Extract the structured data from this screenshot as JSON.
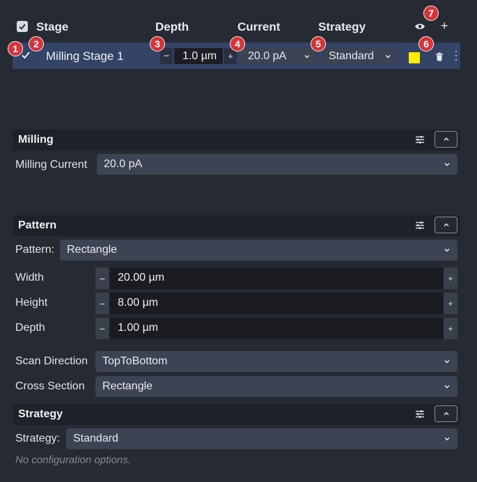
{
  "header": {
    "stage_label": "Stage",
    "depth_label": "Depth",
    "current_label": "Current",
    "strategy_label": "Strategy",
    "add_symbol": "+"
  },
  "stage_row": {
    "name": "Milling Stage 1",
    "depth_minus": "−",
    "depth_value": "1.0 µm",
    "depth_plus": "+",
    "current_value": "20.0 pA",
    "strategy_value": "Standard",
    "color": "#ffee00"
  },
  "badges": [
    "1",
    "2",
    "3",
    "4",
    "5",
    "6",
    "7"
  ],
  "milling": {
    "title": "Milling",
    "current_label": "Milling Current",
    "current_value": "20.0 pA"
  },
  "pattern": {
    "title": "Pattern",
    "pattern_label": "Pattern:",
    "pattern_value": "Rectangle",
    "width_label": "Width",
    "width_value": "20.00 µm",
    "height_label": "Height",
    "height_value": "8.00 µm",
    "depth_label": "Depth",
    "depth_value": "1.00 µm",
    "minus": "−",
    "plus": "+",
    "scan_direction_label": "Scan Direction",
    "scan_direction_value": "TopToBottom",
    "cross_section_label": "Cross Section",
    "cross_section_value": "Rectangle"
  },
  "strategy": {
    "title": "Strategy",
    "strategy_label": "Strategy:",
    "strategy_value": "Standard",
    "hint": "No configuration options."
  }
}
